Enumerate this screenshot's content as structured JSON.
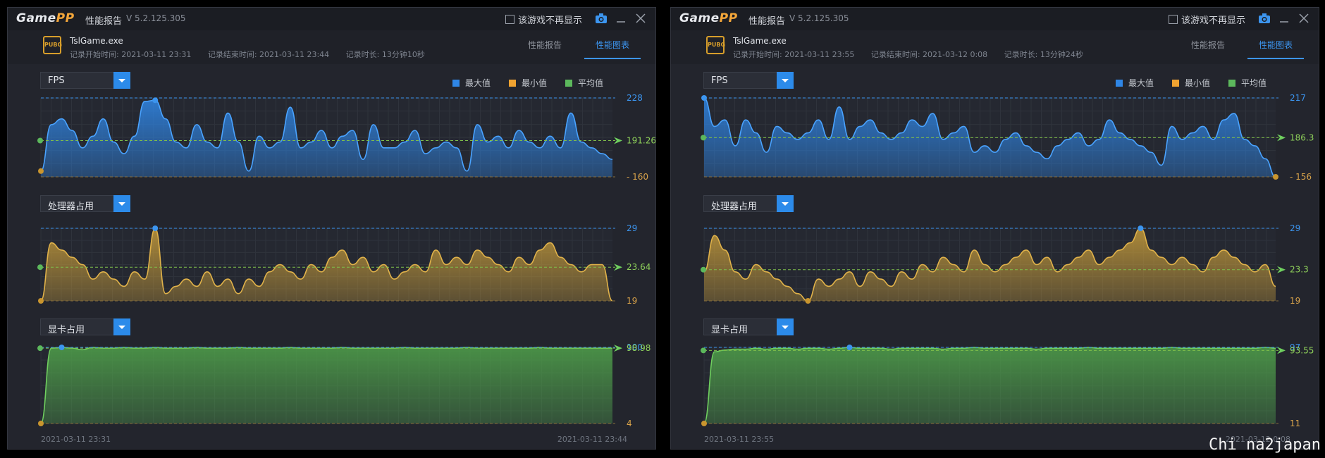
{
  "app": {
    "logo_game": "Game",
    "logo_pp": "PP",
    "title": "性能报告",
    "version": "V 5.2.125.305",
    "hide_label": "该游戏不再显示"
  },
  "tabs": {
    "report": "性能报告",
    "chart": "性能图表"
  },
  "legend": {
    "max": "最大值",
    "min": "最小值",
    "avg": "平均值"
  },
  "colors": {
    "max": "#2f86e6",
    "min": "#f0a331",
    "avg": "#5cb85c",
    "fps": "#2f86e6",
    "cpu": "#c49a3a",
    "gpu": "#4fa14a"
  },
  "icons": {
    "camera": "camera-icon",
    "minimize": "minimize-icon",
    "close": "close-icon",
    "game": "pubg-icon"
  },
  "windows": [
    {
      "exe": "TslGame.exe",
      "start": "记录开始时间: 2021-03-11 23:31",
      "end": "记录结束时间: 2021-03-11 23:44",
      "duration": "记录时长: 13分钟10秒",
      "time_start": "2021-03-11 23:31",
      "time_end": "2021-03-11 23:44",
      "charts": [
        {
          "label": "FPS",
          "max": "228",
          "avg": "191.26",
          "min": "160"
        },
        {
          "label": "处理器占用",
          "max": "29",
          "avg": "23.64",
          "min": "19"
        },
        {
          "label": "显卡占用",
          "max": "100",
          "avg": "98.98",
          "min": "4"
        }
      ]
    },
    {
      "exe": "TslGame.exe",
      "start": "记录开始时间: 2021-03-11 23:55",
      "end": "记录结束时间: 2021-03-12 0:08",
      "duration": "记录时长: 13分钟24秒",
      "time_start": "2021-03-11 23:55",
      "time_end": "2021-03-12 0:08",
      "charts": [
        {
          "label": "FPS",
          "max": "217",
          "avg": "186.3",
          "min": "156"
        },
        {
          "label": "处理器占用",
          "max": "29",
          "avg": "23.3",
          "min": "19"
        },
        {
          "label": "显卡占用",
          "max": "97",
          "avg": "93.55",
          "min": "11"
        }
      ]
    }
  ],
  "chart_data": [
    {
      "type": "area",
      "title": "FPS",
      "ylim": [
        160,
        228
      ],
      "avg": 191.26,
      "values": [
        165,
        205,
        210,
        200,
        185,
        195,
        210,
        190,
        180,
        195,
        225,
        226,
        210,
        190,
        185,
        205,
        190,
        185,
        215,
        190,
        165,
        195,
        185,
        190,
        220,
        185,
        190,
        200,
        185,
        195,
        200,
        175,
        205,
        185,
        185,
        190,
        200,
        180,
        185,
        190,
        185,
        165,
        205,
        190,
        195,
        185,
        200,
        190,
        185,
        195,
        185,
        215,
        190,
        185,
        180,
        175
      ]
    },
    {
      "type": "area",
      "title": "处理器占用",
      "ylim": [
        19,
        29
      ],
      "avg": 23.64,
      "values": [
        19,
        27,
        26,
        25,
        24,
        22,
        23,
        22,
        21,
        23,
        22,
        29,
        20,
        21,
        22,
        21,
        23,
        21,
        22,
        20,
        22,
        21,
        23,
        24,
        23,
        22,
        24,
        23,
        25,
        26,
        24,
        25,
        23,
        24,
        22,
        23,
        24,
        23,
        26,
        24,
        25,
        24,
        26,
        25,
        24,
        23,
        25,
        24,
        26,
        27,
        25,
        24,
        23,
        24,
        24,
        19
      ]
    },
    {
      "type": "area",
      "title": "显卡占用",
      "ylim": [
        4,
        100
      ],
      "avg": 98.98,
      "values": [
        4,
        99,
        100,
        99,
        97,
        100,
        99,
        99,
        100,
        99,
        99,
        100,
        99,
        99,
        99,
        100,
        99,
        99,
        99,
        100,
        99,
        99,
        99,
        99,
        100,
        99,
        99,
        99,
        99,
        100,
        99,
        99,
        99,
        99,
        99,
        100,
        99,
        99,
        99,
        99,
        99,
        100,
        99,
        99,
        99,
        99,
        99,
        99,
        100,
        99,
        99,
        99,
        99,
        99,
        99,
        99
      ]
    },
    {
      "type": "area",
      "title": "FPS",
      "ylim": [
        156,
        217
      ],
      "avg": 186.3,
      "values": [
        217,
        195,
        200,
        180,
        200,
        190,
        175,
        195,
        190,
        185,
        190,
        200,
        185,
        210,
        185,
        195,
        200,
        190,
        185,
        190,
        200,
        195,
        205,
        185,
        190,
        195,
        175,
        180,
        175,
        185,
        190,
        180,
        175,
        170,
        180,
        185,
        190,
        180,
        185,
        200,
        190,
        185,
        180,
        175,
        165,
        195,
        185,
        190,
        195,
        185,
        200,
        205,
        185,
        180,
        170,
        156
      ]
    },
    {
      "type": "area",
      "title": "处理器占用",
      "ylim": [
        19,
        29
      ],
      "avg": 23.3,
      "values": [
        23,
        28,
        26,
        23,
        22,
        24,
        23,
        22,
        21,
        20,
        19,
        22,
        21,
        22,
        23,
        21,
        23,
        22,
        21,
        23,
        22,
        24,
        23,
        25,
        24,
        23,
        26,
        24,
        23,
        24,
        25,
        26,
        24,
        25,
        23,
        24,
        25,
        26,
        24,
        25,
        26,
        27,
        29,
        26,
        25,
        24,
        25,
        24,
        23,
        25,
        26,
        25,
        24,
        23,
        24,
        21
      ]
    },
    {
      "type": "area",
      "title": "显卡占用",
      "ylim": [
        11,
        97
      ],
      "avg": 93.55,
      "values": [
        11,
        92,
        94,
        95,
        95,
        96,
        95,
        96,
        96,
        95,
        96,
        96,
        95,
        96,
        97,
        96,
        96,
        96,
        95,
        96,
        96,
        96,
        96,
        95,
        96,
        96,
        97,
        96,
        96,
        96,
        96,
        96,
        95,
        96,
        96,
        96,
        96,
        97,
        96,
        96,
        96,
        96,
        96,
        96,
        96,
        97,
        96,
        96,
        96,
        96,
        96,
        96,
        96,
        96,
        97,
        96
      ]
    }
  ]
}
